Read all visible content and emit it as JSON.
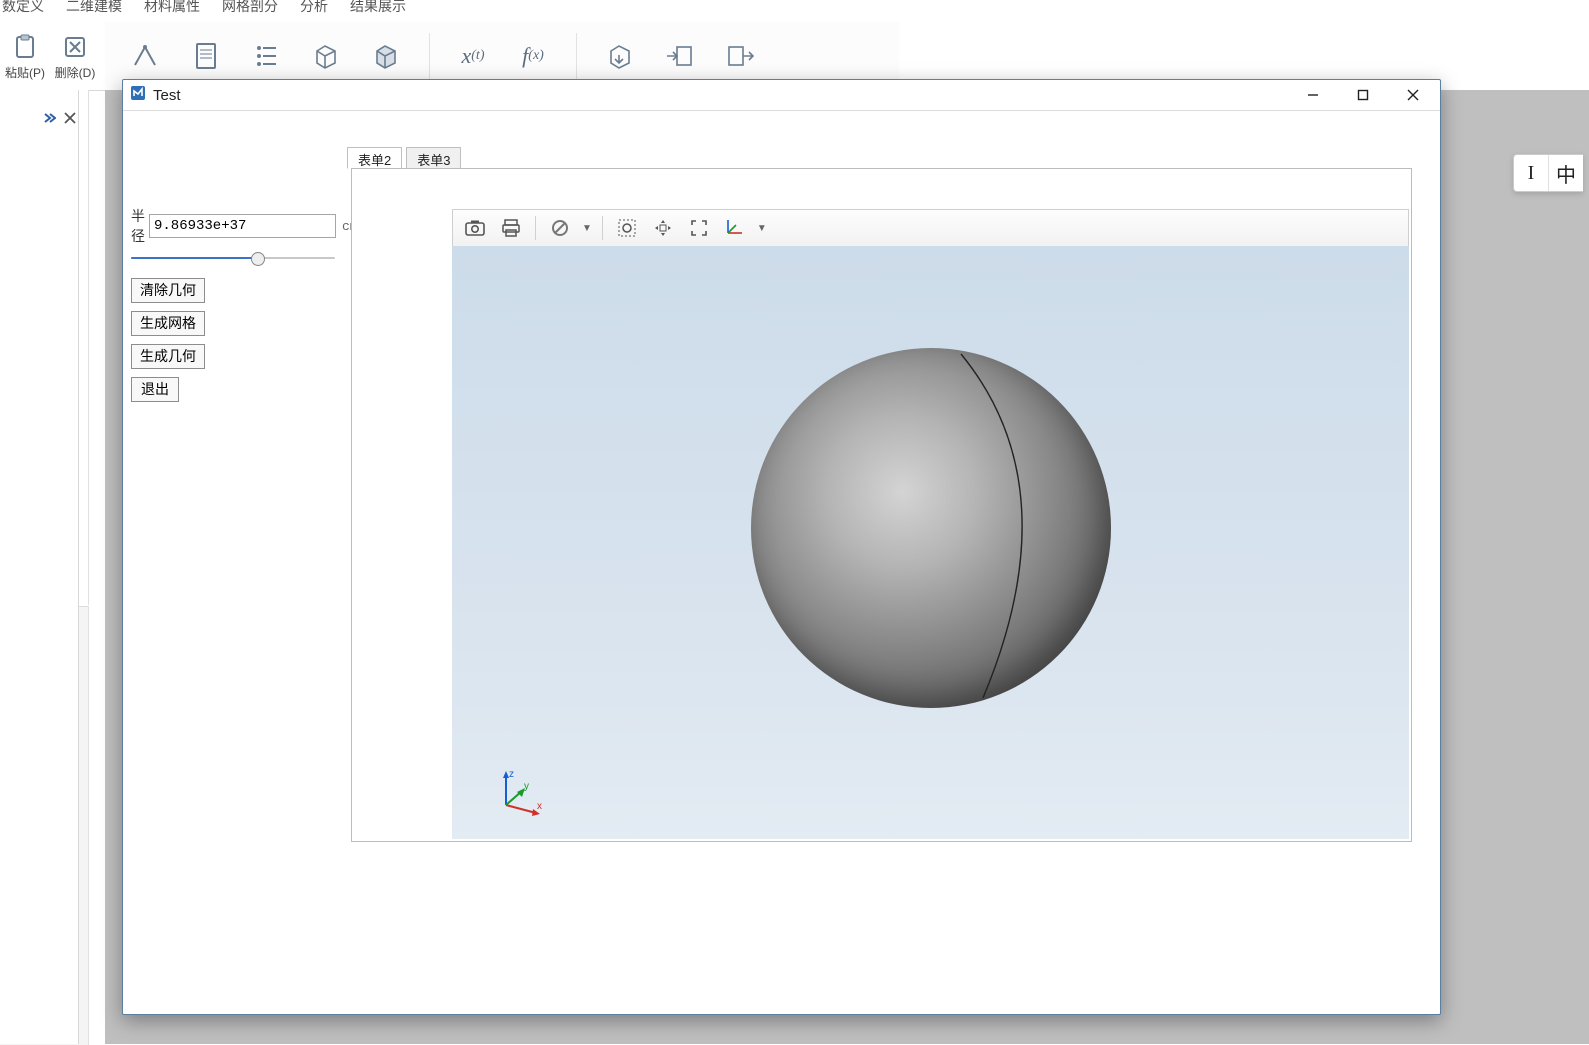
{
  "menu": {
    "items": [
      "数定义",
      "二维建模",
      "材料属性",
      "网格剖分",
      "分析",
      "结果展示"
    ]
  },
  "ribbon_left": {
    "paste": "粘贴(P)",
    "delete": "删除(D)"
  },
  "dialog": {
    "title": "Test"
  },
  "param": {
    "label": "半径",
    "value": "9.86933e+37",
    "unit": "cm",
    "slider_percent": 62
  },
  "buttons": {
    "clear_geom": "清除几何",
    "gen_mesh": "生成网格",
    "gen_geom": "生成几何",
    "exit": "退出"
  },
  "tabs": {
    "items": [
      "表单2",
      "表单3"
    ],
    "active": 0
  },
  "triad": {
    "x": "x",
    "y": "y",
    "z": "z"
  },
  "ime": {
    "mode1": "I",
    "mode2": "中"
  }
}
